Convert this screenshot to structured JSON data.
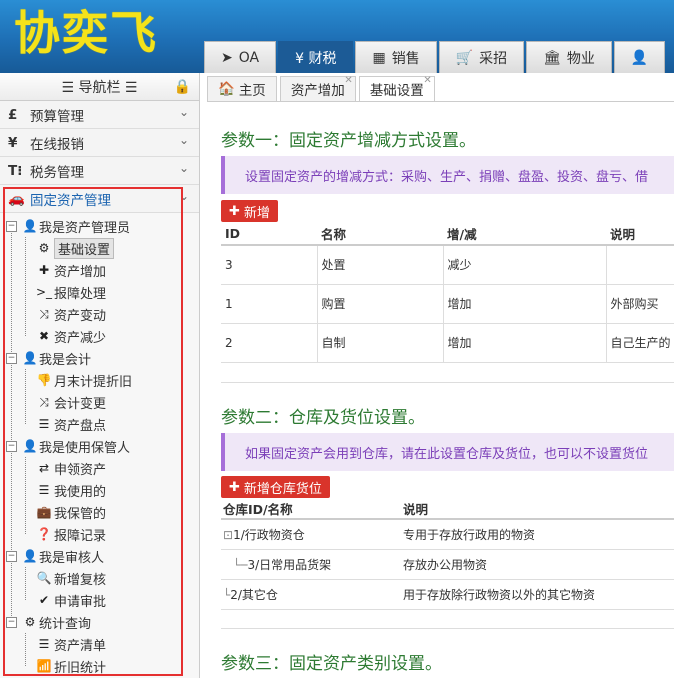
{
  "app": {
    "logo": "协奕飞"
  },
  "nav_tabs": [
    {
      "label": "OA",
      "icon": "paper-plane-icon"
    },
    {
      "label": "¥ 财税",
      "icon": "yen-icon"
    },
    {
      "label": "销售",
      "icon": "grid-icon"
    },
    {
      "label": "采招",
      "icon": "cart-icon"
    },
    {
      "label": "物业",
      "icon": "bank-icon"
    },
    {
      "label": "",
      "icon": "user-icon"
    }
  ],
  "sidebar": {
    "title": "☰ 导航栏 ☰",
    "menus": [
      {
        "icon": "£",
        "label": "预算管理"
      },
      {
        "icon": "¥",
        "label": "在线报销"
      },
      {
        "icon": "T⁝",
        "label": "税务管理"
      },
      {
        "icon": "🚗",
        "label": "固定资产管理"
      }
    ],
    "tree": [
      {
        "label": "我是资产管理员",
        "icon": "👤"
      },
      {
        "label": "基础设置",
        "icon": "⚙"
      },
      {
        "label": "资产增加",
        "icon": "✚"
      },
      {
        "label": "报障处理",
        "icon": ">_"
      },
      {
        "label": "资产变动",
        "icon": "⤨"
      },
      {
        "label": "资产减少",
        "icon": "✖"
      },
      {
        "label": "我是会计",
        "icon": "👤"
      },
      {
        "label": "月末计提折旧",
        "icon": "👎"
      },
      {
        "label": "会计变更",
        "icon": "⤨"
      },
      {
        "label": "资产盘点",
        "icon": "☰"
      },
      {
        "label": "我是使用保管人",
        "icon": "👤"
      },
      {
        "label": "申领资产",
        "icon": "⇄"
      },
      {
        "label": "我使用的",
        "icon": "☰"
      },
      {
        "label": "我保管的",
        "icon": "💼"
      },
      {
        "label": "报障记录",
        "icon": "❓"
      },
      {
        "label": "我是审核人",
        "icon": "👤"
      },
      {
        "label": "新增复核",
        "icon": "🔍"
      },
      {
        "label": "申请审批",
        "icon": "✔"
      },
      {
        "label": "统计查询",
        "icon": "⚙"
      },
      {
        "label": "资产清单",
        "icon": "☰"
      },
      {
        "label": "折旧统计",
        "icon": "📶"
      }
    ]
  },
  "content_tabs": [
    {
      "label": "主页",
      "icon": "home-icon"
    },
    {
      "label": "资产增加"
    },
    {
      "label": "基础设置"
    }
  ],
  "section1": {
    "title": "参数一：固定资产增减方式设置。",
    "note": "设置固定资产的增减方式：采购、生产、捐赠、盘盈、投资、盘亏、借",
    "add_label": "新增",
    "columns": [
      "ID",
      "名称",
      "增/减",
      "说明"
    ],
    "rows": [
      {
        "id": "3",
        "name": "处置",
        "dir": "减少",
        "desc": ""
      },
      {
        "id": "1",
        "name": "购置",
        "dir": "增加",
        "desc": "外部购买"
      },
      {
        "id": "2",
        "name": "自制",
        "dir": "增加",
        "desc": "自己生产的"
      }
    ]
  },
  "section2": {
    "title": "参数二：仓库及货位设置。",
    "note": "如果固定资产会用到仓库，请在此设置仓库及货位，也可以不设置货位",
    "add_label": "新增仓库货位",
    "columns": [
      "仓库ID/名称",
      "说明"
    ],
    "rows": [
      {
        "name": "1/行政物资仓",
        "desc": "专用于存放行政用的物资"
      },
      {
        "name": "3/日常用品货架",
        "desc": "存放办公用物资"
      },
      {
        "name": "2/其它仓",
        "desc": "用于存放除行政物资以外的其它物资"
      }
    ]
  },
  "section3": {
    "title": "参数三：固定资产类别设置。"
  }
}
